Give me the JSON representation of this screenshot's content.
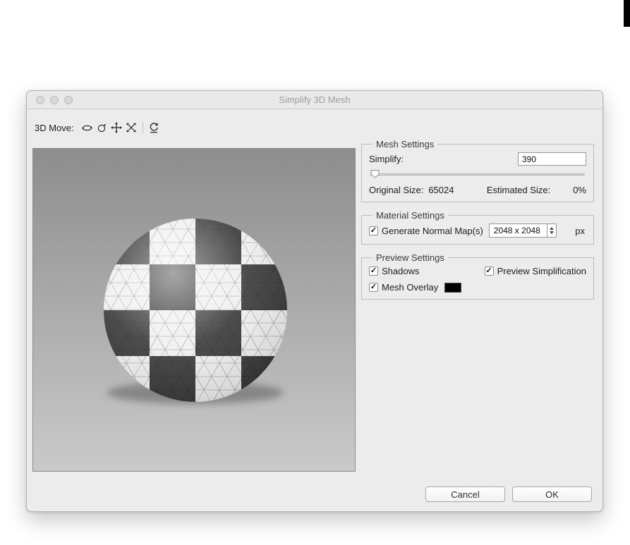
{
  "window": {
    "title": "Simplify 3D Mesh"
  },
  "toolbar": {
    "label": "3D Move:",
    "tools": [
      "orbit",
      "roll",
      "pan",
      "slide",
      "reset-camera"
    ]
  },
  "mesh": {
    "group_title": "Mesh Settings",
    "simplify_label": "Simplify:",
    "simplify_value": "390",
    "original_label": "Original Size:",
    "original_value": "65024",
    "estimated_label": "Estimated Size:",
    "estimated_value": "0%"
  },
  "material": {
    "group_title": "Material Settings",
    "normal_map_label": "Generate Normal Map(s)",
    "normal_map_checked": true,
    "size_value": "2048 x 2048",
    "unit_label": "px"
  },
  "preview": {
    "group_title": "Preview Settings",
    "shadows_label": "Shadows",
    "shadows_checked": true,
    "simplification_label": "Preview Simplification",
    "simplification_checked": true,
    "mesh_overlay_label": "Mesh Overlay",
    "mesh_overlay_checked": true,
    "overlay_color": "#000000"
  },
  "actions": {
    "cancel": "Cancel",
    "ok": "OK"
  },
  "ui": {
    "checkmark": "✓"
  }
}
